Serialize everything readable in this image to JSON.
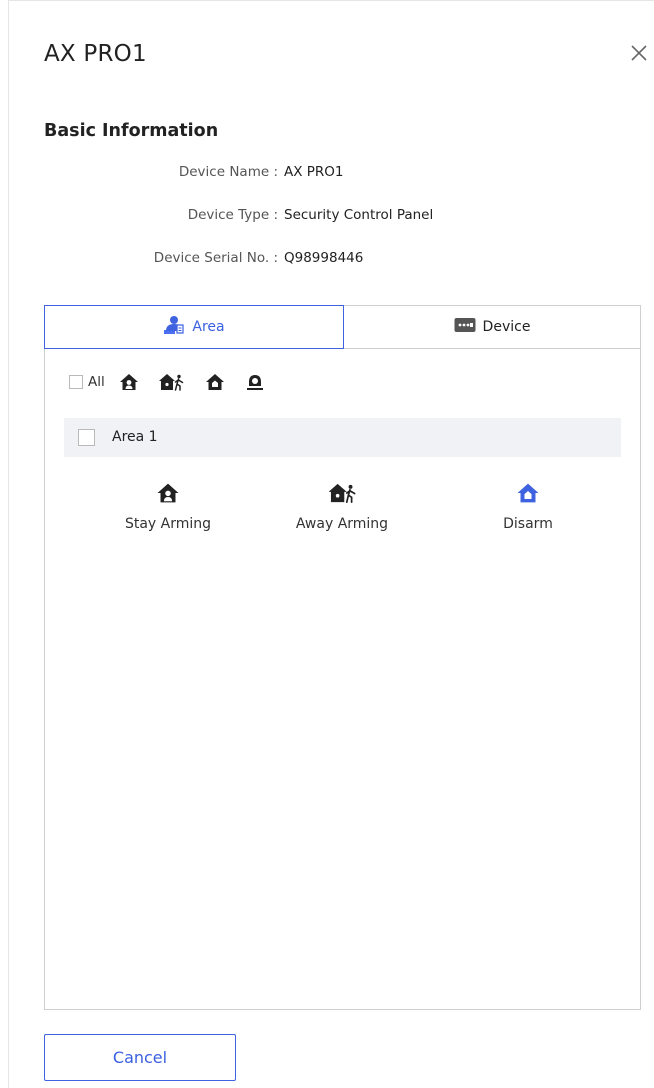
{
  "dialog": {
    "title": "AX PRO1",
    "close_icon": "close-icon"
  },
  "basic_info": {
    "section_title": "Basic Information",
    "rows": [
      {
        "label": "Device Name :",
        "value": "AX PRO1"
      },
      {
        "label": "Device Type :",
        "value": "Security Control Panel"
      },
      {
        "label": "Device Serial No. :",
        "value": "Q98998446"
      }
    ]
  },
  "tabs": [
    {
      "label": "Area",
      "icon": "area-icon",
      "active": true
    },
    {
      "label": "Device",
      "icon": "device-icon",
      "active": false
    }
  ],
  "toolbar": {
    "all_label": "All",
    "icons": [
      "stay-arming-icon",
      "away-arming-icon",
      "disarm-icon",
      "clear-alarm-icon"
    ]
  },
  "areas": [
    {
      "name": "Area 1",
      "checked": false
    }
  ],
  "actions": [
    {
      "label": "Stay Arming",
      "icon": "stay-arming-icon",
      "color": "#222222"
    },
    {
      "label": "Away Arming",
      "icon": "away-arming-icon",
      "color": "#222222"
    },
    {
      "label": "Disarm",
      "icon": "disarm-icon",
      "color": "#3e62e0"
    }
  ],
  "footer": {
    "cancel_label": "Cancel"
  },
  "colors": {
    "accent": "#3e62e0",
    "row_background": "#f0f2f5",
    "border": "#cfcfcf"
  }
}
